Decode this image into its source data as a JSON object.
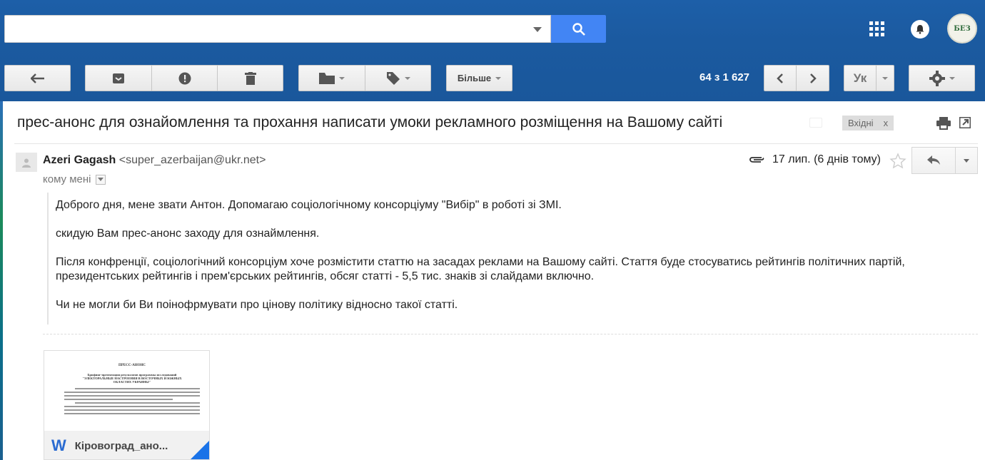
{
  "search": {
    "value": "",
    "placeholder": ""
  },
  "account": {
    "avatar_text": "БЕЗ"
  },
  "toolbar": {
    "more_label": "Більше",
    "pager": "64 з 1 627",
    "lang": "Ук"
  },
  "message": {
    "subject": "прес-анонс для ознайомлення та прохання написати умоки рекламного розміщення на Вашому сайті",
    "label": "Вхідні",
    "label_close": "x",
    "sender_name": "Azeri Gagash",
    "sender_email": "<super_azerbaijan@ukr.net>",
    "to": "кому мені",
    "date": "17 лип. (6 днів тому)",
    "paragraphs": [
      "Доброго дня, мене звати Антон. Допомагаю соціологічному консорціуму \"Вибір\" в роботі зі ЗМІ.",
      "скидую Вам прес-анонс заходу для ознаймлення.",
      "Після конфренції, соціологічний консорціум хоче розмістити статтю на засадах реклами на Вашому сайті. Стаття буде стосуватись рейтингів політичних партій, президентських рейтингів і прем'єрських рейтингів, обсяг статті - 5,5 тис. знаків зі слайдами включно.",
      "Чи не могли би Ви поінофрмувати про цінову політику відносно такої статті."
    ]
  },
  "attachment": {
    "name": "Кіровоград_ано...",
    "preview_title": "ПРЕСС-АНОНС",
    "preview_heading": "Брифинг-презентация результатов программы исследований \"ЭЛЕКТОРАЛЬНЫЕ НАСТРОЕНИЯ В ВОСТОЧНЫХ И ЮЖНЫХ ОБЛАСТЯХ УКРАИНЫ\""
  },
  "colors": {
    "topbar": "#1d5fa8",
    "search_button": "#4285f4",
    "accent": "#1a73e8"
  }
}
